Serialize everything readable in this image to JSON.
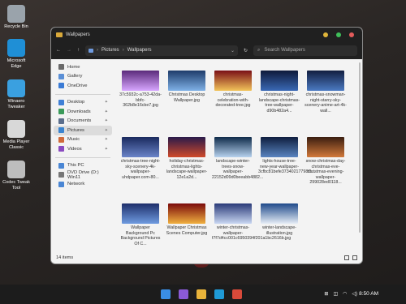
{
  "desktop": {
    "icons": [
      {
        "label": "Recycle Bin",
        "color": "#9aa3ab"
      },
      {
        "label": "Microsoft Edge",
        "color": "#1f8fd6"
      },
      {
        "label": "Winaero Tweaker",
        "color": "#3aa0e0"
      },
      {
        "label": "Media Player Classic",
        "color": "#d8d8d8"
      },
      {
        "label": "Codec Tweak Tool",
        "color": "#bdbdbd"
      }
    ]
  },
  "window": {
    "title": "Wallpapers",
    "breadcrumb": [
      "Pictures",
      "Wallpapers"
    ],
    "search_placeholder": "Search Wallpapers",
    "status": "14 items"
  },
  "nav": {
    "top": [
      {
        "label": "Home",
        "color": "#6a6a6a"
      },
      {
        "label": "Gallery",
        "color": "#5a8fd6"
      },
      {
        "label": "OneDrive",
        "color": "#3a7bd5"
      }
    ],
    "quick": [
      {
        "label": "Desktop",
        "color": "#3e7fd6"
      },
      {
        "label": "Downloads",
        "color": "#3a9a5a"
      },
      {
        "label": "Documents",
        "color": "#5b6e8c"
      },
      {
        "label": "Pictures",
        "color": "#3a84d0"
      },
      {
        "label": "Music",
        "color": "#d06a3a"
      },
      {
        "label": "Videos",
        "color": "#8a4ac0"
      }
    ],
    "devices": [
      {
        "label": "This PC",
        "color": "#4a86d4"
      },
      {
        "label": "DVD Drive (D:) Win11",
        "color": "#777777"
      },
      {
        "label": "Network",
        "color": "#4a86d4"
      }
    ]
  },
  "files": [
    {
      "name": "37c5932c-a753-42da-bbfc-362b8e16cbe7.jpg",
      "c1": "#5a2a7a",
      "c2": "#d7a6ff"
    },
    {
      "name": "Christmas Desktop Wallpaper.jpg",
      "c1": "#1e3b6a",
      "c2": "#7fb1e6"
    },
    {
      "name": "christmas-celebration-with-decorated-tree.jpg",
      "c1": "#7a0f16",
      "c2": "#f2c45a"
    },
    {
      "name": "christmas-night-landscape-christmas-tree-wallpaper-d90b482a4...",
      "c1": "#0e1a3a",
      "c2": "#3a69b5"
    },
    {
      "name": "christmas-snowman-night-starry-sky-scenery-anime-art-4k-wall...",
      "c1": "#121e40",
      "c2": "#4b7ac2"
    },
    {
      "name": "christmas-tree-night-sky-scenery-4k-wallpaper-uhdpaper.com-80...",
      "c1": "#1a2a5e",
      "c2": "#6a84c8"
    },
    {
      "name": "holiday-christmas-christmas-lights-landscape-wallpaper-12e1a2d...",
      "c1": "#2a1a4a",
      "c2": "#d04a2a"
    },
    {
      "name": "landscape-winter-trees-snow-wallpaper-22152d09d0beeabb4882...",
      "c1": "#0f2b4a",
      "c2": "#b7d2ee"
    },
    {
      "name": "lights-house-tree-new-year-wallpaper-3cfbc81befe37340217798f1...",
      "c1": "#0f1e3e",
      "c2": "#5a84c0"
    },
    {
      "name": "snow-christmas-day-christmas-eve-christmas-evening-wallpaper-299028ed0118...",
      "c1": "#3a1e10",
      "c2": "#d2793a"
    },
    {
      "name": "Wallpaper Background Pc Background Pictures Of C...",
      "c1": "#1e2e6a",
      "c2": "#6f9be0"
    },
    {
      "name": "Wallpaper Christmas Scenes Computer.jpg",
      "c1": "#7a0a0a",
      "c2": "#f0b040"
    },
    {
      "name": "winter-christmas-wallpaper-f7f7d4cc001c6950394f201a1bc2616b.jpg",
      "c1": "#2a3a78",
      "c2": "#c9d7f2"
    },
    {
      "name": "winter-landscape-illustration.jpg",
      "c1": "#1f4a8a",
      "c2": "#e6edf6"
    }
  ],
  "taskbar": {
    "apps": [
      {
        "name": "start-icon",
        "color": "#3a8ee6"
      },
      {
        "name": "copilot-icon",
        "color": "#8a5ad6"
      },
      {
        "name": "file-explorer-icon",
        "color": "#e8b33a"
      },
      {
        "name": "edge-icon",
        "color": "#1f9ad6"
      },
      {
        "name": "store-icon",
        "color": "#d84a3a"
      }
    ],
    "time": "8:50 AM"
  }
}
